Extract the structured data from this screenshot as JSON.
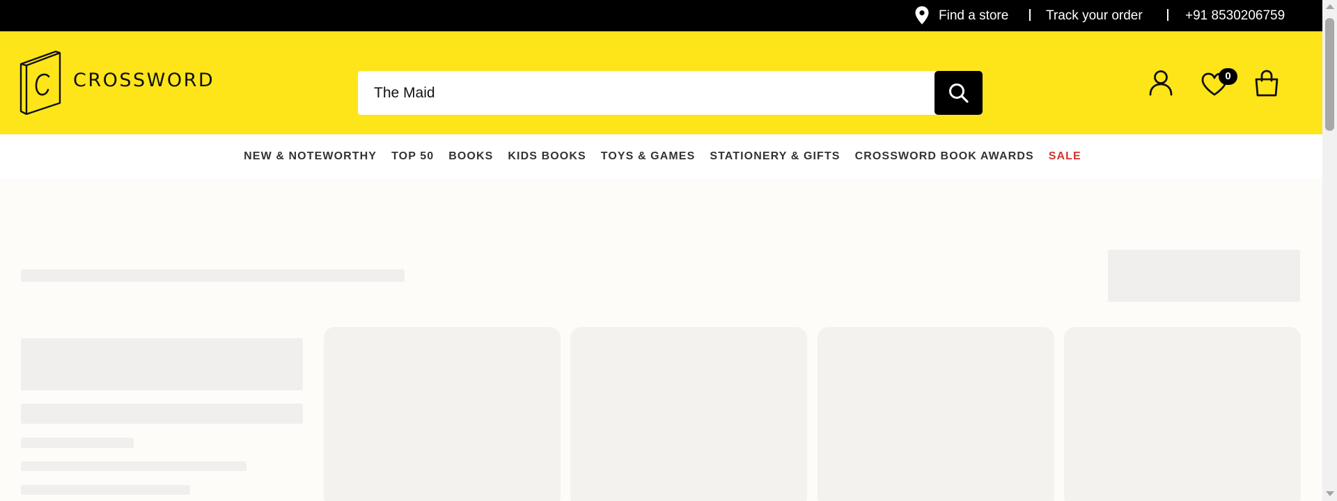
{
  "topbar": {
    "find_store": "Find a store",
    "track_order": "Track your order",
    "phone": "+91 8530206759"
  },
  "header": {
    "logo_text": "CROSSWORD",
    "search_value": "The Maid",
    "wishlist_count": "0"
  },
  "nav": {
    "items": [
      "NEW & NOTEWORTHY",
      "TOP 50",
      "BOOKS",
      "KIDS BOOKS",
      "TOYS & GAMES",
      "STATIONERY & GIFTS",
      "CROSSWORD BOOK AWARDS",
      "SALE"
    ]
  },
  "icons": {
    "location": "location-pin-icon",
    "search": "search-icon",
    "account": "user-icon",
    "wishlist": "heart-icon",
    "cart": "shopping-bag-icon"
  },
  "colors": {
    "brand_yellow": "#fde51a",
    "topbar": "#000000",
    "sale": "#d0342c",
    "skeleton": "#f0efed"
  }
}
